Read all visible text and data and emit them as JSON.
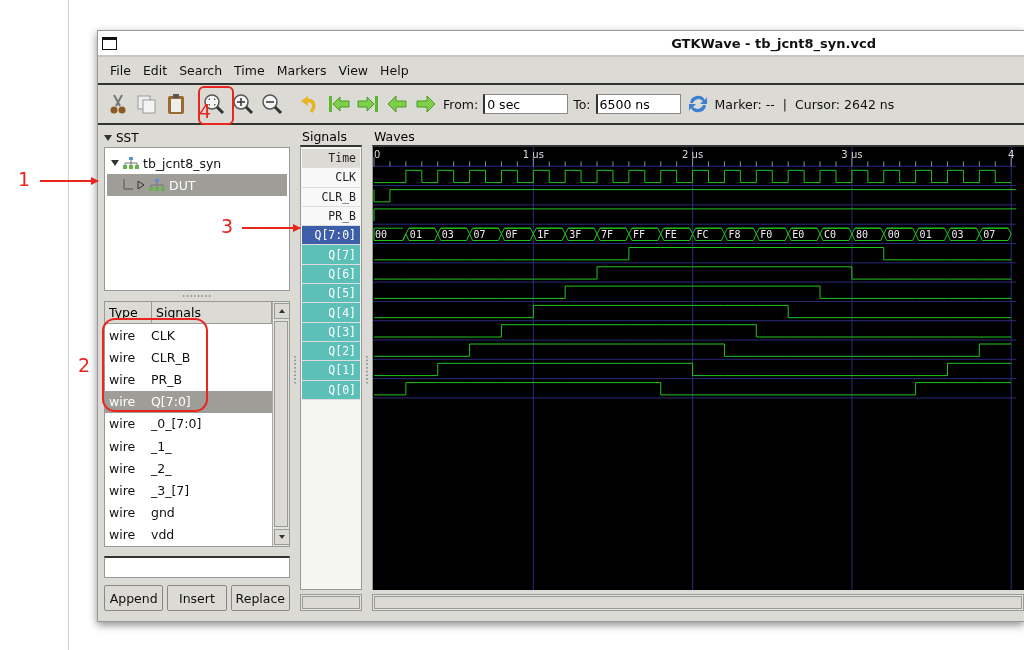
{
  "window": {
    "title": "GTKWave - tb_jcnt8_syn.vcd"
  },
  "menu": [
    "File",
    "Edit",
    "Search",
    "Time",
    "Markers",
    "View",
    "Help"
  ],
  "toolbar": {
    "from_label": "From:",
    "from_value": "0 sec",
    "to_label": "To:",
    "to_value": "6500 ns",
    "marker": "Marker: --",
    "separator": "|",
    "cursor": "Cursor: 2642 ns"
  },
  "sst": {
    "title": "SST",
    "expanded": true,
    "tree": [
      {
        "label": "tb_jcnt8_syn",
        "expanded": true,
        "selected": false,
        "children": [
          {
            "label": "DUT",
            "expanded": false,
            "selected": true
          }
        ]
      }
    ]
  },
  "signal_list": {
    "columns": [
      "Type",
      "Signals"
    ],
    "rows": [
      {
        "type": "wire",
        "name": "CLK",
        "selected": false
      },
      {
        "type": "wire",
        "name": "CLR_B",
        "selected": false
      },
      {
        "type": "wire",
        "name": "PR_B",
        "selected": false
      },
      {
        "type": "wire",
        "name": "Q[7:0]",
        "selected": true
      },
      {
        "type": "wire",
        "name": "_0_[7:0]",
        "selected": false
      },
      {
        "type": "wire",
        "name": "_1_",
        "selected": false
      },
      {
        "type": "wire",
        "name": "_2_",
        "selected": false
      },
      {
        "type": "wire",
        "name": "_3_[7]",
        "selected": false
      },
      {
        "type": "wire",
        "name": "gnd",
        "selected": false
      },
      {
        "type": "wire",
        "name": "vdd",
        "selected": false
      }
    ]
  },
  "buttons": [
    "Append",
    "Insert",
    "Replace"
  ],
  "signals_pane": {
    "title": "Signals",
    "rows": [
      {
        "name": "Time",
        "kind": "time",
        "selected": false,
        "highlighted": false
      },
      {
        "name": "CLK",
        "kind": "clock",
        "selected": false,
        "highlighted": false
      },
      {
        "name": "CLR_B",
        "kind": "reset",
        "selected": false,
        "highlighted": false
      },
      {
        "name": "PR_B",
        "kind": "constant",
        "selected": false,
        "highlighted": false
      },
      {
        "name": "Q[7:0]",
        "kind": "bus",
        "selected": true,
        "highlighted": false
      },
      {
        "name": "Q[7]",
        "kind": "bit",
        "selected": false,
        "highlighted": true
      },
      {
        "name": "Q[6]",
        "kind": "bit",
        "selected": false,
        "highlighted": true
      },
      {
        "name": "Q[5]",
        "kind": "bit",
        "selected": false,
        "highlighted": true
      },
      {
        "name": "Q[4]",
        "kind": "bit",
        "selected": false,
        "highlighted": true
      },
      {
        "name": "Q[3]",
        "kind": "bit",
        "selected": false,
        "highlighted": true
      },
      {
        "name": "Q[2]",
        "kind": "bit",
        "selected": false,
        "highlighted": true
      },
      {
        "name": "Q[1]",
        "kind": "bit",
        "selected": false,
        "highlighted": true
      },
      {
        "name": "Q[0]",
        "kind": "bit",
        "selected": false,
        "highlighted": true
      }
    ]
  },
  "waves": {
    "title": "Waves",
    "time_labels": [
      "0",
      "1 us",
      "2 us",
      "3 us",
      "4"
    ],
    "bus_values": [
      "00",
      "01",
      "03",
      "07",
      "0F",
      "1F",
      "3F",
      "7F",
      "FF",
      "FE",
      "FC",
      "F8",
      "F0",
      "E0",
      "C0",
      "80",
      "00",
      "01",
      "03",
      "07"
    ]
  },
  "annotations": [
    {
      "label": "1"
    },
    {
      "label": "2"
    },
    {
      "label": "3"
    },
    {
      "label": "4"
    }
  ]
}
